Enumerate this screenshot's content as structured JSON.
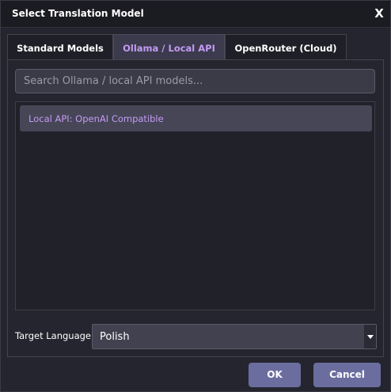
{
  "window": {
    "title": "Select Translation Model",
    "close_label": "X"
  },
  "tabs": [
    {
      "label": "Standard Models",
      "selected": false
    },
    {
      "label": "Ollama / Local API",
      "selected": true
    },
    {
      "label": "OpenRouter (Cloud)",
      "selected": false
    }
  ],
  "search": {
    "value": "",
    "placeholder": "Search Ollama / local API models..."
  },
  "models": [
    {
      "label": "Local API: OpenAI Compatible",
      "selected": true
    }
  ],
  "target_language": {
    "label": "Target Language:",
    "value": "Polish"
  },
  "buttons": {
    "ok_label": "OK",
    "cancel_label": "Cancel"
  },
  "colors": {
    "accent": "#c49bf2",
    "button": "#6b6d9f",
    "background": "#25252f"
  }
}
